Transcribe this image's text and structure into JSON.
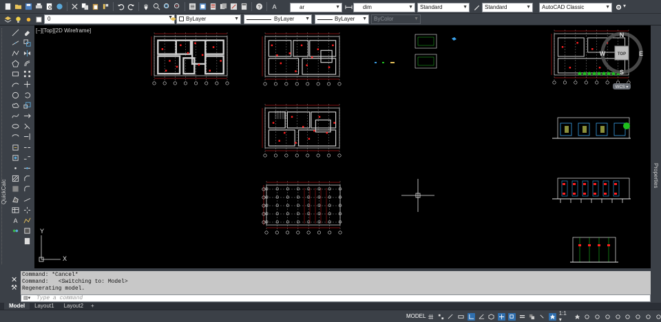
{
  "toolbar1": {
    "layer_name": "ar",
    "dimstyle": "dim",
    "textstyle": "Standard",
    "tablestyle": "Standard",
    "workspace": "AutoCAD Classic"
  },
  "toolbar2": {
    "current_layer": "0",
    "color": "ByLayer",
    "linetype": "ByLayer",
    "lineweight": "ByLayer",
    "plotstyle": "ByColor"
  },
  "palette": {
    "label": "QuickCalc"
  },
  "canvas": {
    "viewport_label": "[−][Top][2D Wireframe]",
    "viewcube": {
      "top": "TOP",
      "north": "N",
      "south": "S",
      "east": "E",
      "west": "W",
      "ucs": "WCS"
    }
  },
  "props_strip": {
    "label": "Properties"
  },
  "command": {
    "history": [
      "Command: *Cancel*",
      "Command:   <Switching to: Model>",
      "Regenerating model."
    ],
    "placeholder": "Type a command"
  },
  "tabs": [
    {
      "label": "Model",
      "active": true
    },
    {
      "label": "Layout1",
      "active": false
    },
    {
      "label": "Layout2",
      "active": false
    }
  ],
  "status": {
    "mode": "MODEL",
    "scale": "1:1"
  },
  "colors": {
    "bg": "#000000",
    "panel": "#3b4047",
    "accent": "#2f6fae",
    "drawing_red": "#ff2020",
    "drawing_white": "#e8e8e8",
    "drawing_green": "#1fbf1f"
  }
}
